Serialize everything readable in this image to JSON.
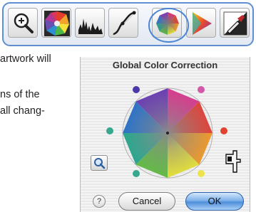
{
  "toolbar": {
    "tools": [
      {
        "icon": "magnifier-icon"
      },
      {
        "icon": "color-balance-icon"
      },
      {
        "icon": "histogram-icon"
      },
      {
        "icon": "curves-icon"
      },
      {
        "icon": "color-wheel-icon",
        "selected": true
      },
      {
        "icon": "color-triangle-icon"
      },
      {
        "icon": "eyedropper-icon"
      }
    ],
    "accent": "#4a86d4"
  },
  "body_text": {
    "line1": "artwork will",
    "line2": "ns of the",
    "line3": "all chang-"
  },
  "dialog": {
    "title": "Global Color Correction",
    "cancel_label": "Cancel",
    "ok_label": "OK",
    "help_glyph": "?"
  }
}
